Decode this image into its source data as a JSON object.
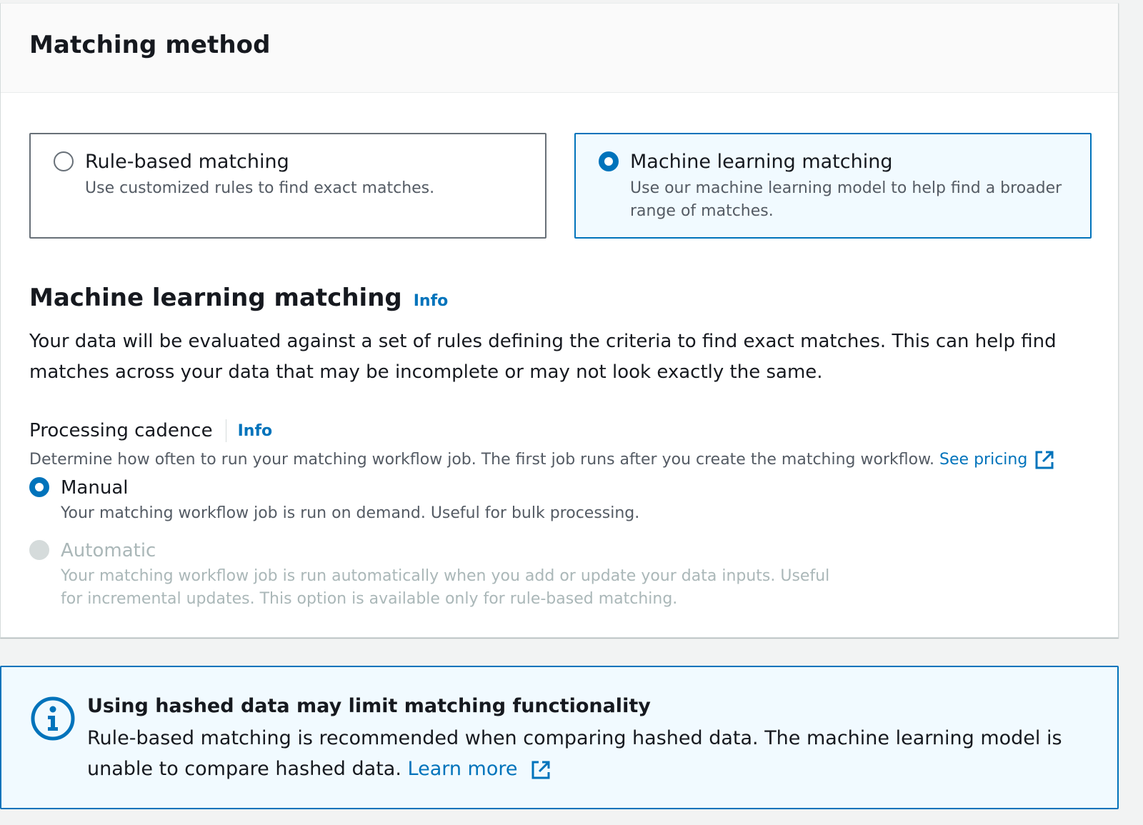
{
  "container": {
    "title": "Matching method"
  },
  "tiles": [
    {
      "label": "Rule-based matching",
      "description": "Use customized rules to find exact matches.",
      "selected": false
    },
    {
      "label": "Machine learning matching",
      "description": "Use our machine learning model to help find a broader range of matches.",
      "selected": true
    }
  ],
  "section": {
    "title": "Machine learning matching",
    "info": "Info",
    "description": "Your data will be evaluated against a set of rules defining the criteria to find exact matches. This can help find matches across your data that may be incomplete or may not look exactly the same."
  },
  "processing_cadence": {
    "label": "Processing cadence",
    "info": "Info",
    "description": "Determine how often to run your matching workflow job. The first job runs after you create the matching workflow.",
    "pricing_link": "See pricing",
    "options": [
      {
        "label": "Manual",
        "description": "Your matching workflow job is run on demand. Useful for bulk processing.",
        "selected": true,
        "disabled": false
      },
      {
        "label": "Automatic",
        "description": "Your matching workflow job is run automatically when you add or update your data inputs. Useful for incremental updates. This option is available only for rule-based matching.",
        "selected": false,
        "disabled": true
      }
    ]
  },
  "alert": {
    "title": "Using hashed data may limit matching functionality",
    "body": "Rule-based matching is recommended when comparing hashed data. The machine learning model is unable to compare hashed data.",
    "link": "Learn more",
    "icon": "info-circle-icon"
  },
  "colors": {
    "accent": "#0073bb",
    "selected_bg": "#f1faff",
    "text": "#16191f",
    "secondary_text": "#545b64",
    "disabled_text": "#aab7b8"
  }
}
